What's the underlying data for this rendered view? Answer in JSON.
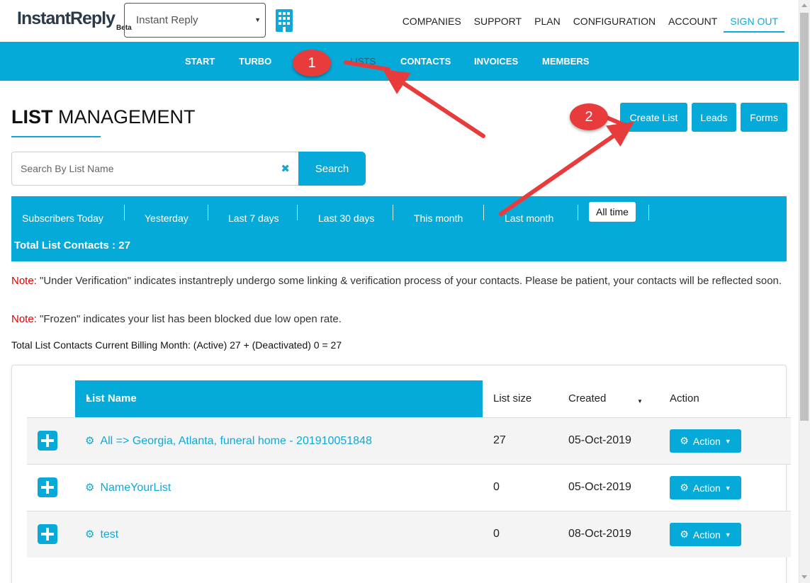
{
  "brand": {
    "name": "InstantReply",
    "badge": "Beta"
  },
  "company_select": {
    "value": "Instant Reply"
  },
  "top_nav": [
    "COMPANIES",
    "SUPPORT",
    "PLAN",
    "CONFIGURATION",
    "ACCOUNT",
    "SIGN OUT"
  ],
  "sub_nav": {
    "start": "START",
    "turbo": "TURBO",
    "lists": "LISTS",
    "contacts": "CONTACTS",
    "invoices": "INVOICES",
    "members": "MEMBERS"
  },
  "page": {
    "title_bold": "LIST",
    "title_rest": "MANAGEMENT"
  },
  "buttons": {
    "create_list": "Create List",
    "leads": "Leads",
    "forms": "Forms"
  },
  "search": {
    "placeholder": "Search By List Name",
    "clear": "✖",
    "button": "Search"
  },
  "filters": [
    "Subscribers Today",
    "Yesterday",
    "Last 7 days",
    "Last 30 days",
    "This month",
    "Last month",
    "All time"
  ],
  "selected_filter": "All time",
  "total_contacts": "Total List Contacts : 27",
  "notes": [
    {
      "label": "Note:",
      "text": " \"Under Verification\" indicates instantreply undergo some linking & verification process of your contacts. Please be patient, your contacts will be reflected soon."
    },
    {
      "label": "Note:",
      "text": " \"Frozen\" indicates your list has been blocked due low open rate."
    }
  ],
  "billing_summary": "Total List Contacts Current Billing Month: (Active) 27 + (Deactivated) 0 = 27",
  "table": {
    "headers": {
      "name": "List Name",
      "size": "List size",
      "created": "Created",
      "action": "Action"
    },
    "rows": [
      {
        "name": "All => Georgia, Atlanta, funeral home - 201910051848",
        "size": "27",
        "created": "05-Oct-2019",
        "action": "Action"
      },
      {
        "name": "NameYourList",
        "size": "0",
        "created": "05-Oct-2019",
        "action": "Action"
      },
      {
        "name": "test",
        "size": "0",
        "created": "08-Oct-2019",
        "action": "Action"
      }
    ]
  },
  "annotations": {
    "step1": "1",
    "step2": "2",
    "color": "#e83c3c"
  },
  "colors": {
    "accent": "#06aad9",
    "note_label": "#e10000"
  }
}
